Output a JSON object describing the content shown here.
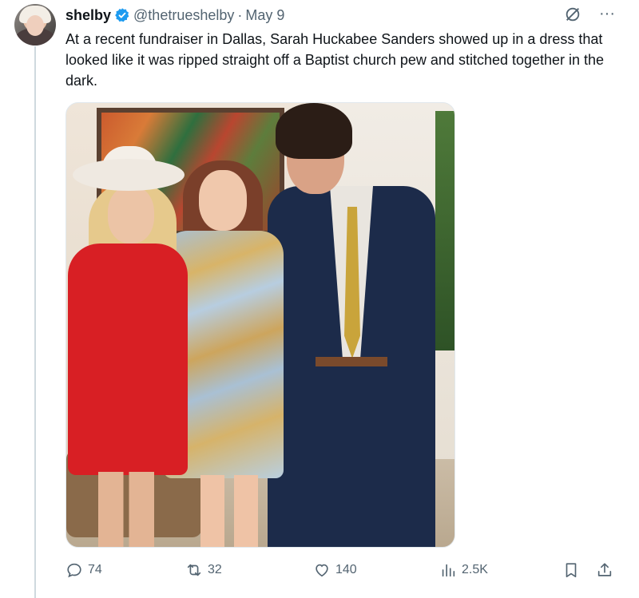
{
  "tweet": {
    "author_name": "shelby",
    "handle": "@thetrueshelby",
    "separator": "·",
    "date": "May 9",
    "text": "At a recent fundraiser in Dallas, Sarah Huckabee Sanders showed up in a dress that looked like it was ripped straight off a Baptist church pew and stitched together in the dark."
  },
  "header_icons": {
    "grok": "slashed-circle-icon",
    "more": "···"
  },
  "metrics": {
    "replies": "74",
    "retweets": "32",
    "likes": "140",
    "views": "2.5K"
  },
  "colors": {
    "text": "#0f1419",
    "secondary": "#536471",
    "verified": "#1d9bf0",
    "thread_line": "#cfd9de"
  },
  "icons": [
    "reply-icon",
    "retweet-icon",
    "like-icon",
    "views-icon",
    "bookmark-icon",
    "share-icon"
  ]
}
